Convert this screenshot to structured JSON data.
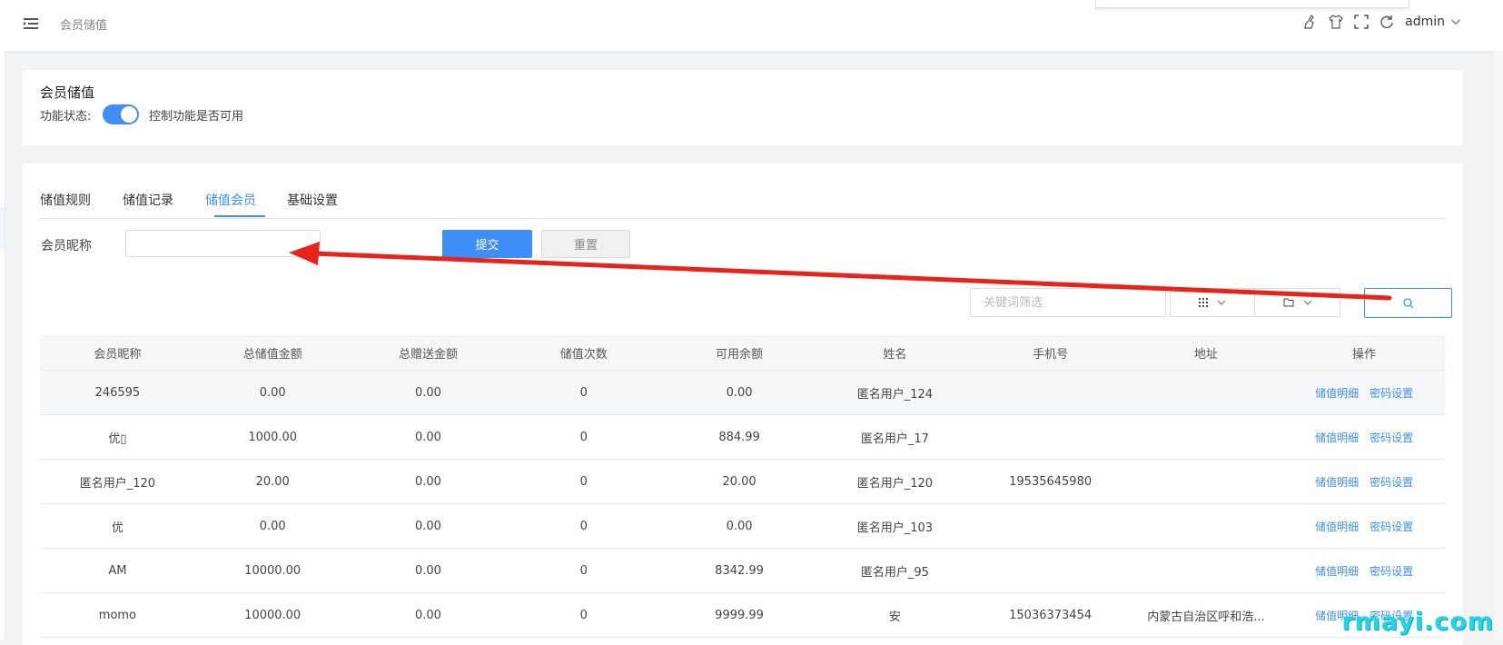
{
  "header": {
    "page_title": "会员储值",
    "user_name": "admin",
    "icons": [
      "broom-icon",
      "tshirt-icon",
      "fullscreen-icon",
      "refresh-icon",
      "chevron-down-icon"
    ]
  },
  "settings_card": {
    "title": "会员储值",
    "status_label": "功能状态:",
    "toggle_on": true,
    "toggle_hint": "控制功能是否可用"
  },
  "tabs": [
    {
      "label": "储值规则",
      "active": false
    },
    {
      "label": "储值记录",
      "active": false
    },
    {
      "label": "储值会员",
      "active": true
    },
    {
      "label": "基础设置",
      "active": false
    }
  ],
  "filter": {
    "nickname_label": "会员昵称",
    "nickname_value": "",
    "submit_label": "提交",
    "reset_label": "重置"
  },
  "toolbar": {
    "keyword_placeholder": "关键词筛选"
  },
  "table": {
    "columns": [
      "会员昵称",
      "总储值金额",
      "总赠送金额",
      "储值次数",
      "可用余额",
      "姓名",
      "手机号",
      "地址",
      "操作"
    ],
    "rows": [
      {
        "nickname": "246595",
        "total": "0.00",
        "gift": "0.00",
        "count": "0",
        "balance": "0.00",
        "name": "匿名用户_124",
        "phone": "",
        "address": ""
      },
      {
        "nickname": "优▯",
        "total": "1000.00",
        "gift": "0.00",
        "count": "0",
        "balance": "884.99",
        "name": "匿名用户_17",
        "phone": "",
        "address": ""
      },
      {
        "nickname": "匿名用户_120",
        "total": "20.00",
        "gift": "0.00",
        "count": "0",
        "balance": "20.00",
        "name": "匿名用户_120",
        "phone": "19535645980",
        "address": ""
      },
      {
        "nickname": "优",
        "total": "0.00",
        "gift": "0.00",
        "count": "0",
        "balance": "0.00",
        "name": "匿名用户_103",
        "phone": "",
        "address": ""
      },
      {
        "nickname": "AM",
        "total": "10000.00",
        "gift": "0.00",
        "count": "0",
        "balance": "8342.99",
        "name": "匿名用户_95",
        "phone": "",
        "address": ""
      },
      {
        "nickname": "momo",
        "total": "10000.00",
        "gift": "0.00",
        "count": "0",
        "balance": "9999.99",
        "name": "安",
        "phone": "15036373454",
        "address": "内蒙古自治区呼和浩..."
      }
    ],
    "action_detail": "储值明细",
    "action_password": "密码设置"
  },
  "annotation": {
    "color": "#e8231b"
  },
  "watermark": "rmayi.com",
  "colors": {
    "accent": "#3d8ef7",
    "header_bg": "#f5f6f8"
  }
}
